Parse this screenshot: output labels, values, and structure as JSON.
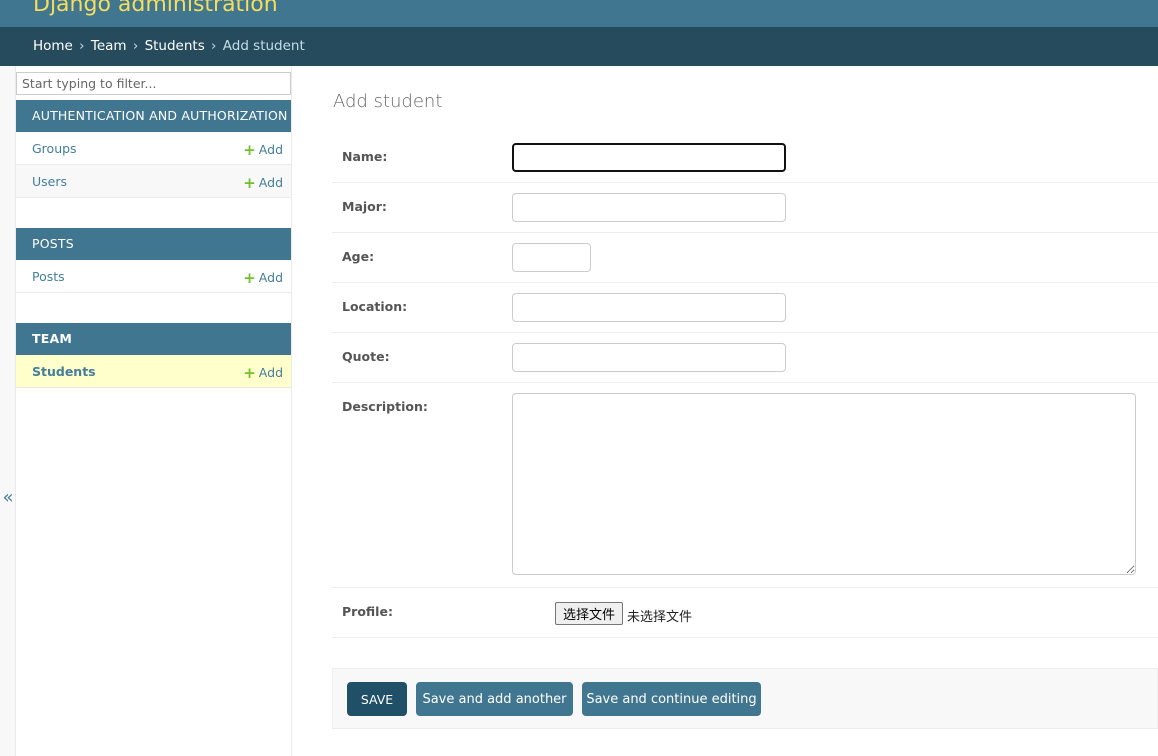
{
  "header": {
    "site_title": "Django administration"
  },
  "breadcrumbs": {
    "home": "Home",
    "app": "Team",
    "model": "Students",
    "current": "Add student",
    "separator": "›"
  },
  "sidebar": {
    "filter_placeholder": "Start typing to filter...",
    "toggle_glyph": "«",
    "apps": [
      {
        "caption": "AUTHENTICATION AND AUTHORIZATION",
        "models": [
          {
            "name": "Groups",
            "add": "Add"
          },
          {
            "name": "Users",
            "add": "Add"
          }
        ]
      },
      {
        "caption": "POSTS",
        "models": [
          {
            "name": "Posts",
            "add": "Add"
          }
        ]
      },
      {
        "caption": "TEAM",
        "models": [
          {
            "name": "Students",
            "add": "Add"
          }
        ]
      }
    ]
  },
  "form": {
    "title": "Add student",
    "fields": {
      "name": {
        "label": "Name:",
        "value": ""
      },
      "major": {
        "label": "Major:",
        "value": ""
      },
      "age": {
        "label": "Age:",
        "value": ""
      },
      "location": {
        "label": "Location:",
        "value": ""
      },
      "quote": {
        "label": "Quote:",
        "value": ""
      },
      "description": {
        "label": "Description:",
        "value": ""
      },
      "profile": {
        "label": "Profile:",
        "button": "选择文件",
        "status": "未选择文件"
      }
    }
  },
  "actions": {
    "save": "SAVE",
    "save_add": "Save and add another",
    "save_continue": "Save and continue editing"
  },
  "colors": {
    "header": "#417690",
    "breadcrumbs": "#264b5d",
    "title": "#f5dd5d",
    "link": "#447e9b",
    "current_row": "#ffffcc",
    "add_plus": "#70bf2b",
    "save_button": "#205067"
  }
}
